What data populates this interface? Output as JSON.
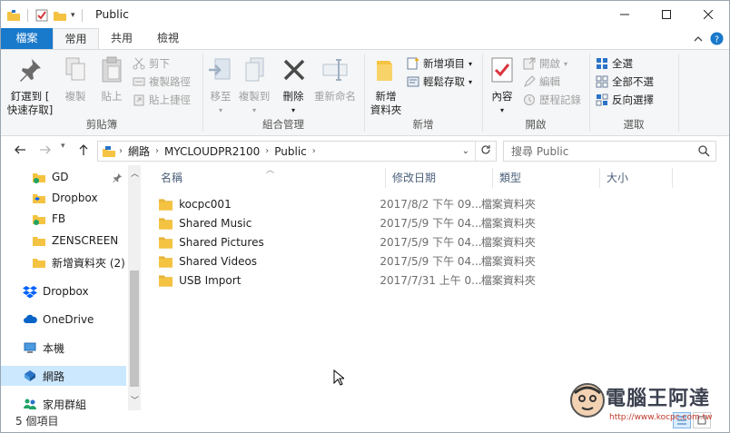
{
  "window": {
    "title": "Public",
    "minimize": "—",
    "maximize": "☐",
    "close": "✕"
  },
  "ribbon_tabs": [
    "檔案",
    "常用",
    "共用",
    "檢視"
  ],
  "ribbon": {
    "clipboard": {
      "pin_label_1": "釘選到 [",
      "pin_label_2": "快速存取]",
      "copy": "複製",
      "paste": "貼上",
      "cut": "剪下",
      "copy_path": "複製路徑",
      "paste_shortcut": "貼上捷徑",
      "group": "剪貼簿"
    },
    "organize": {
      "move_to": "移至",
      "copy_to": "複製到",
      "delete": "刪除",
      "rename": "重新命名",
      "group": "組合管理"
    },
    "new": {
      "new_folder_1": "新增",
      "new_folder_2": "資料夾",
      "new_item": "新增項目",
      "easy_access": "輕鬆存取",
      "group": "新增"
    },
    "open": {
      "properties": "內容",
      "open": "開啟",
      "edit": "編輯",
      "history": "歷程記錄",
      "group": "開啟"
    },
    "select": {
      "select_all": "全選",
      "select_none": "全部不選",
      "invert": "反向選擇",
      "group": "選取"
    }
  },
  "address": {
    "crumbs": [
      "網路",
      "MYCLOUDPR2100",
      "Public"
    ],
    "search_placeholder": "搜尋 Public"
  },
  "nav_pane": {
    "items": [
      {
        "label": "GD",
        "icon": "folder-pinned-icon"
      },
      {
        "label": "Dropbox",
        "icon": "dropbox-folder-icon"
      },
      {
        "label": "FB",
        "icon": "folder-sync-icon"
      },
      {
        "label": "ZENSCREEN",
        "icon": "folder-icon"
      },
      {
        "label": "新增資料夾 (2)",
        "icon": "folder-icon"
      },
      {
        "label": "Dropbox",
        "icon": "dropbox-icon"
      },
      {
        "label": "OneDrive",
        "icon": "onedrive-icon"
      },
      {
        "label": "本機",
        "icon": "computer-icon"
      },
      {
        "label": "網路",
        "icon": "network-icon"
      },
      {
        "label": "家用群組",
        "icon": "homegroup-icon"
      }
    ]
  },
  "columns": [
    "名稱",
    "修改日期",
    "類型",
    "大小"
  ],
  "files": [
    {
      "name": "kocpc001",
      "date": "2017/8/2 下午 09...",
      "type": "檔案資料夾"
    },
    {
      "name": "Shared Music",
      "date": "2017/5/9 下午 04...",
      "type": "檔案資料夾"
    },
    {
      "name": "Shared Pictures",
      "date": "2017/5/9 下午 04...",
      "type": "檔案資料夾"
    },
    {
      "name": "Shared Videos",
      "date": "2017/5/9 下午 04...",
      "type": "檔案資料夾"
    },
    {
      "name": "USB Import",
      "date": "2017/7/31 上午 0...",
      "type": "檔案資料夾"
    }
  ],
  "status": {
    "item_count": "5 個項目"
  },
  "watermark": {
    "text": "電腦王阿達",
    "url": "http://www.kocpc.com.tw"
  },
  "colors": {
    "accent": "#1979ca",
    "folder": "#f5c342",
    "selection": "#cce8ff"
  }
}
